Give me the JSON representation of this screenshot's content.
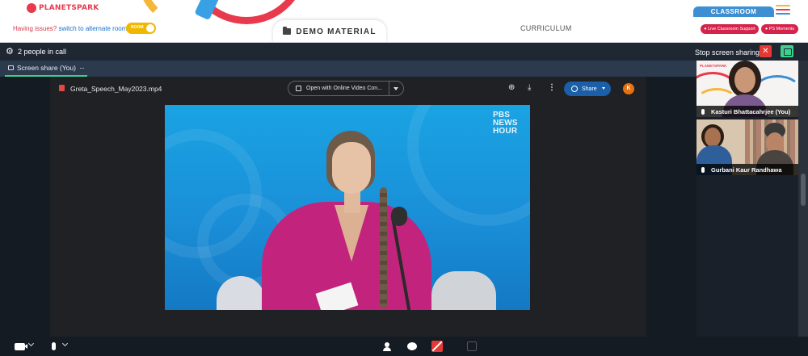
{
  "header": {
    "logo_text": "PLANETSPARK",
    "issues_text": "Having issues?",
    "issues_link": "switch to alternate room",
    "toggle_label": "ROOM",
    "demo_material": "DEMO MATERIAL",
    "curriculum": "CURRICULUM",
    "classroom": "CLASSROOM",
    "live_support": "Live Classroom Support",
    "ps_moments": "PS Moments",
    "hamburger_colors": [
      "#f6b63a",
      "#e8394d",
      "#3d8fd1"
    ]
  },
  "call": {
    "people_count": "2 people in call",
    "stop_sharing": "Stop screen sharing",
    "close_symbol": "✕"
  },
  "tabs": [
    {
      "label": "Screen share (You)",
      "more": "···"
    }
  ],
  "viewer": {
    "file_name": "Greta_Speech_May2023.mp4",
    "open_with": "Open with Online Video Con...",
    "share_label": "Share",
    "avatar_letter": "K",
    "more_symbol": "⋮",
    "add_symbol": "⊕",
    "download_symbol": "⤓"
  },
  "video": {
    "watermark_line1": "PBS",
    "watermark_line2": "NEWS",
    "watermark_line3": "HOUR"
  },
  "participants": [
    {
      "name": "Kasturi Bhattacahrjee (You)"
    },
    {
      "name": "Gurbani Kaur Randhawa"
    }
  ],
  "tile_logo": "PLANETSPARK",
  "colors": {
    "accent_green": "#3ecf8e",
    "alert_red": "#e53935",
    "brand_red": "#e8394d",
    "classroom_blue": "#3d8fd1",
    "share_blue": "#1a5fa8"
  },
  "icons": [
    "gear-icon",
    "monitor-icon",
    "folder-icon",
    "file-icon",
    "globe-icon",
    "mic-icon",
    "camera-icon",
    "person-icon",
    "chat-icon",
    "share-screen-off-icon"
  ]
}
